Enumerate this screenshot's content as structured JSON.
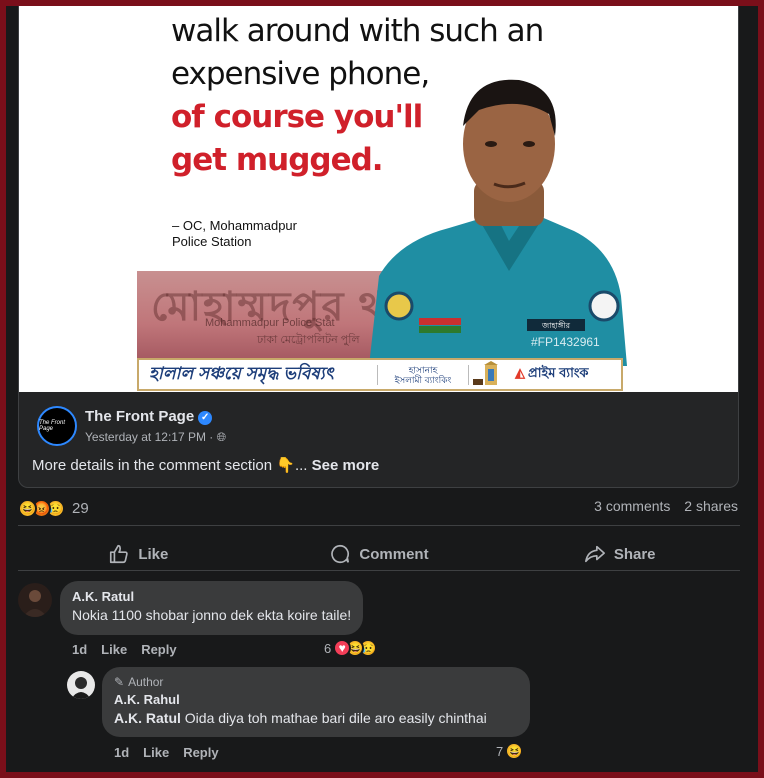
{
  "image": {
    "quote_lines": [
      "walk around with such an",
      "expensive phone,"
    ],
    "quote_red_lines": [
      "of course you'll",
      "get mugged."
    ],
    "attribution_line1": "– OC, Mohammadpur",
    "attribution_line2": "Police Station",
    "banner_big_text": "মোহাম্মদপুর থ",
    "banner_en_text": "Mohammadpur Police Stat",
    "banner_bn_text": "ঢাকা মেট্রোপলিটন পুলি",
    "badge_text": "#FP1432961",
    "nameplate": "জাহাঙ্গীর",
    "ad_left": "হালাল সঞ্চয়ে সমৃদ্ধ ভবিষ্যৎ",
    "ad_mid_line1": "হাসানাহ",
    "ad_mid_line2": "ইসলামী ব্যাংকিং",
    "ad_right": "প্রাইম ব্যাংক"
  },
  "post": {
    "page_name": "The Front Page",
    "avatar_text": "The Front Page",
    "time": "Yesterday at 12:17 PM · ",
    "text": "More details in the comment section 👇... ",
    "see_more": "See more"
  },
  "stats": {
    "reaction_count": "29",
    "comments": "3 comments",
    "shares": "2 shares"
  },
  "actions": {
    "like": "Like",
    "comment": "Comment",
    "share": "Share"
  },
  "comments": [
    {
      "author": "A.K. Ratul",
      "text": "Nokia 1100 shobar jonno dek ekta koire taile!",
      "time": "1d",
      "like": "Like",
      "reply": "Reply",
      "reaction_count": "6"
    },
    {
      "badge": "Author",
      "author": "A.K. Rahul",
      "mention": "A.K. Ratul",
      "text": " Oida diya toh mathae bari dile aro easily chinthai",
      "time": "1d",
      "like": "Like",
      "reply": "Reply",
      "reaction_count": "7"
    }
  ],
  "colors": {
    "frame": "#7a0f1a",
    "background": "#18191a",
    "card": "#242526",
    "bubble": "#3a3b3c",
    "accent_blue": "#2d88ff",
    "quote_red": "#d0202a"
  }
}
